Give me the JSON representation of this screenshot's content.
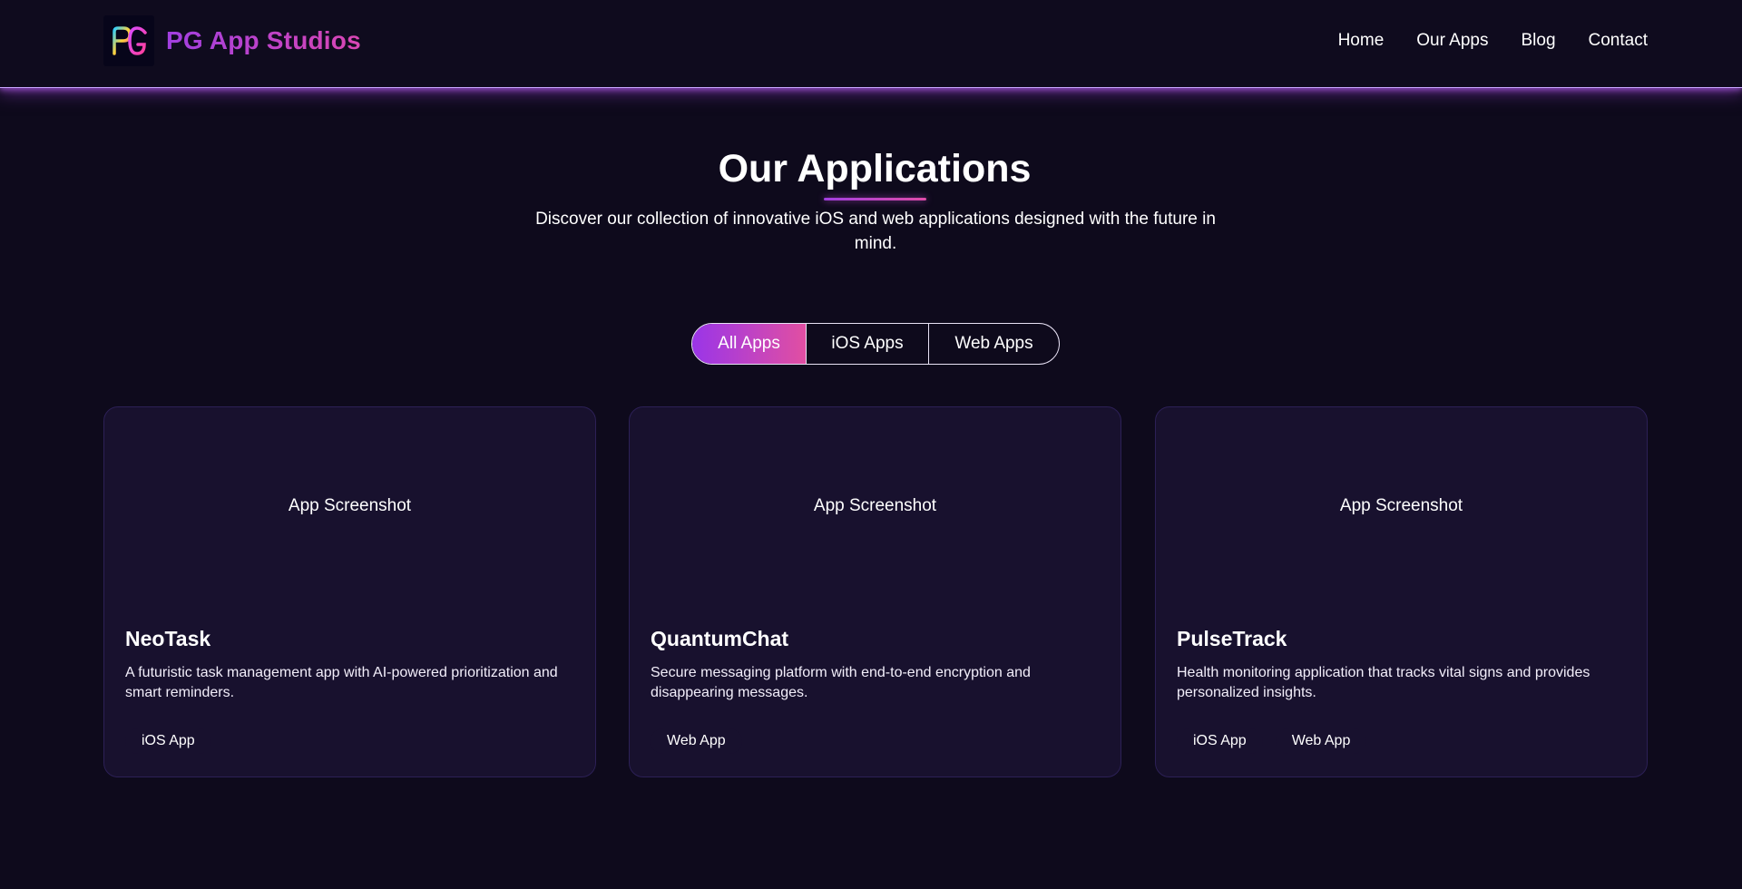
{
  "header": {
    "brand": "PG App Studios",
    "logo_text": "PG",
    "nav": [
      "Home",
      "Our Apps",
      "Blog",
      "Contact"
    ]
  },
  "hero": {
    "title": "Our Applications",
    "subtitle": "Discover our collection of innovative iOS and web applications designed with the future in mind."
  },
  "filters": {
    "items": [
      "All Apps",
      "iOS Apps",
      "Web Apps"
    ],
    "active": "All Apps"
  },
  "apps": [
    {
      "screenshot_label": "App Screenshot",
      "name": "NeoTask",
      "description": "A futuristic task management app with AI-powered prioritization and smart reminders.",
      "tags": [
        "iOS App"
      ]
    },
    {
      "screenshot_label": "App Screenshot",
      "name": "QuantumChat",
      "description": "Secure messaging platform with end-to-end encryption and disappearing messages.",
      "tags": [
        "Web App"
      ]
    },
    {
      "screenshot_label": "App Screenshot",
      "name": "PulseTrack",
      "description": "Health monitoring application that tracks vital signs and provides personalized insights.",
      "tags": [
        "iOS App",
        "Web App"
      ]
    }
  ],
  "colors": {
    "background": "#0e0a1c",
    "accent_purple": "#a13fe0",
    "accent_pink": "#e14fa2",
    "card": "#18112e"
  }
}
